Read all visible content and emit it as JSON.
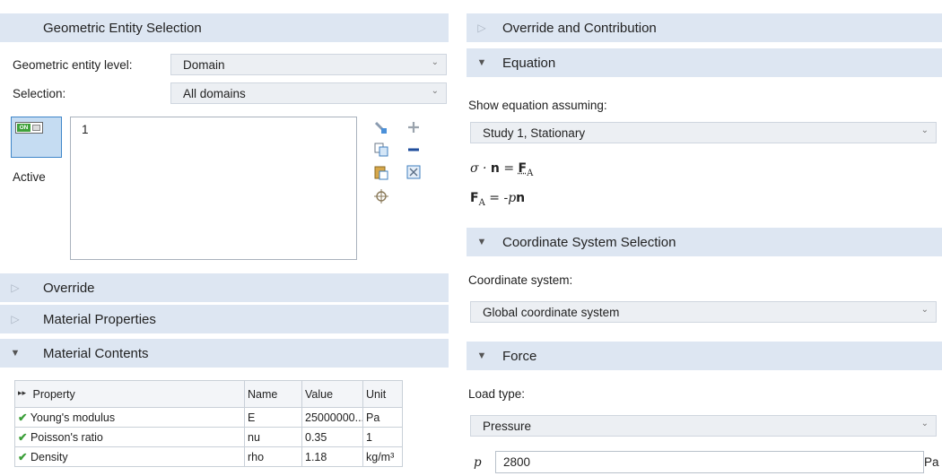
{
  "left": {
    "geo_header": "Geometric Entity Selection",
    "entity_level_label": "Geometric entity level:",
    "entity_level_value": "Domain",
    "selection_label": "Selection:",
    "selection_value": "All domains",
    "active_label": "Active",
    "toggle_on": "ON",
    "selected_items": [
      "1"
    ],
    "override_header": "Override",
    "material_properties_header": "Material Properties",
    "material_contents_header": "Material Contents",
    "table": {
      "columns": [
        "Property",
        "Name",
        "Value",
        "Unit"
      ],
      "rows": [
        {
          "property": "Young's modulus",
          "name": "E",
          "value": "25000000...",
          "unit": "Pa"
        },
        {
          "property": "Poisson's ratio",
          "name": "nu",
          "value": "0.35",
          "unit": "1"
        },
        {
          "property": "Density",
          "name": "rho",
          "value": "1.18",
          "unit": "kg/m³"
        }
      ]
    }
  },
  "right": {
    "override_header": "Override and Contribution",
    "equation_header": "Equation",
    "show_eq_label": "Show equation assuming:",
    "show_eq_value": "Study 1, Stationary",
    "eq1_sigma": "σ · ",
    "eq1_n": "n",
    "eq1_eq": " = ",
    "eq1_F": "F",
    "eq1_sub": "A",
    "eq2_F": "F",
    "eq2_sub": "A",
    "eq2_rest": " = -",
    "eq2_p": "p",
    "eq2_n": "n",
    "coord_header": "Coordinate System Selection",
    "coord_label": "Coordinate system:",
    "coord_value": "Global coordinate system",
    "force_header": "Force",
    "load_type_label": "Load type:",
    "load_type_value": "Pressure",
    "p_label": "p",
    "p_value": "2800",
    "p_unit": "Pa"
  },
  "colors": {
    "section_header_bg": "#dde6f2",
    "combo_bg": "#eceff3",
    "check_green": "#3c9f3a",
    "toggle_blue": "#3f86c9"
  }
}
